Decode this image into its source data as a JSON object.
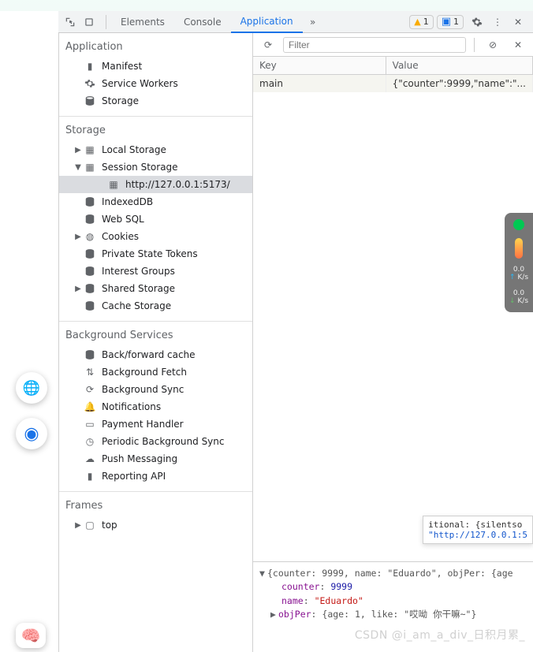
{
  "tabs": {
    "elements": "Elements",
    "console": "Console",
    "application": "Application",
    "warning_count": "1",
    "message_count": "1"
  },
  "sidebar": {
    "groups": [
      {
        "title": "Application",
        "items": [
          {
            "icon": "document-icon",
            "label": "Manifest",
            "expandable": false
          },
          {
            "icon": "gear-icon",
            "label": "Service Workers",
            "expandable": false
          },
          {
            "icon": "database-icon",
            "label": "Storage",
            "expandable": false
          }
        ]
      },
      {
        "title": "Storage",
        "items": [
          {
            "icon": "grid-icon",
            "label": "Local Storage",
            "expandable": true,
            "arrow": "▶"
          },
          {
            "icon": "grid-icon",
            "label": "Session Storage",
            "expandable": true,
            "arrow": "▼",
            "children": [
              {
                "icon": "grid-icon",
                "label": "http://127.0.0.1:5173/",
                "selected": true
              }
            ]
          },
          {
            "icon": "database-icon",
            "label": "IndexedDB",
            "expandable": false
          },
          {
            "icon": "database-icon",
            "label": "Web SQL",
            "expandable": false
          },
          {
            "icon": "cookie-icon",
            "label": "Cookies",
            "expandable": true,
            "arrow": "▶"
          },
          {
            "icon": "database-icon",
            "label": "Private State Tokens",
            "expandable": false
          },
          {
            "icon": "database-icon",
            "label": "Interest Groups",
            "expandable": false
          },
          {
            "icon": "database-icon",
            "label": "Shared Storage",
            "expandable": true,
            "arrow": "▶"
          },
          {
            "icon": "database-icon",
            "label": "Cache Storage",
            "expandable": false
          }
        ]
      },
      {
        "title": "Background Services",
        "items": [
          {
            "icon": "database-icon",
            "label": "Back/forward cache"
          },
          {
            "icon": "sync-down-icon",
            "label": "Background Fetch"
          },
          {
            "icon": "sync-icon",
            "label": "Background Sync"
          },
          {
            "icon": "bell-icon",
            "label": "Notifications"
          },
          {
            "icon": "card-icon",
            "label": "Payment Handler"
          },
          {
            "icon": "clock-icon",
            "label": "Periodic Background Sync"
          },
          {
            "icon": "cloud-icon",
            "label": "Push Messaging"
          },
          {
            "icon": "document-icon",
            "label": "Reporting API"
          }
        ]
      },
      {
        "title": "Frames",
        "items": [
          {
            "icon": "window-icon",
            "label": "top",
            "expandable": true,
            "arrow": "▶"
          }
        ]
      }
    ]
  },
  "filter": {
    "placeholder": "Filter"
  },
  "table": {
    "headers": {
      "key": "Key",
      "value": "Value"
    },
    "rows": [
      {
        "key": "main",
        "value": "{\"counter\":9999,\"name\":\"..."
      }
    ]
  },
  "gauges": {
    "stat1": "0.0",
    "stat1_unit": "K/s",
    "stat2": "0.0",
    "stat2_unit": "K/s"
  },
  "tooltip": {
    "line1_prefix": "itional:",
    "line1_suffix": " {silentso",
    "line2": "\"http://127.0.0.1:5"
  },
  "console": {
    "line1": "{counter: 9999, name: \"Eduardo\", objPer: {age",
    "counter_key": "counter",
    "counter_val": "9999",
    "name_key": "name",
    "name_val": "\"Eduardo\"",
    "objper_key": "objPer",
    "objper_val": "{age: 1, like: \"哎呦 你干嘛~\"}"
  },
  "watermark": "CSDN @i_am_a_div_日积月累_"
}
